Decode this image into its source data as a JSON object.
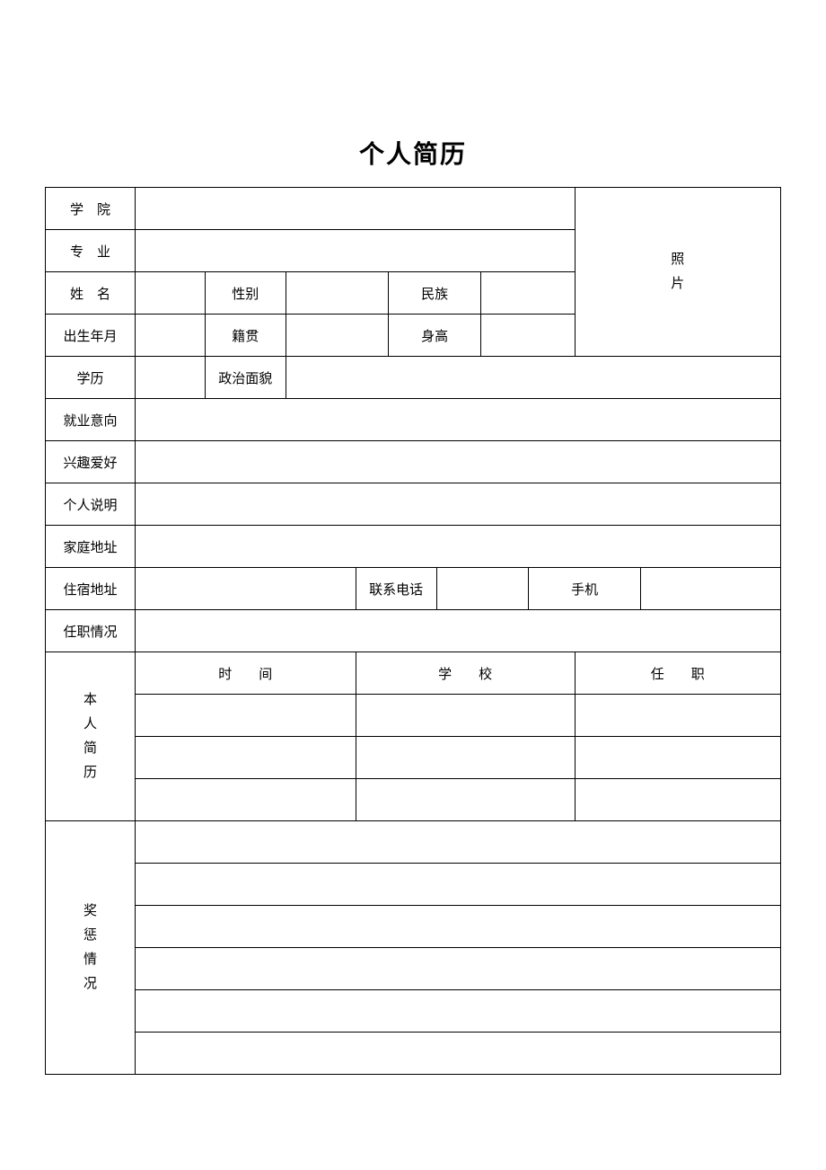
{
  "title": "个人简历",
  "labels": {
    "college": "学　院",
    "major": "专　业",
    "name": "姓　名",
    "gender": "性别",
    "ethnicity": "民族",
    "birth": "出生年月",
    "origin": "籍贯",
    "height": "身高",
    "education": "学历",
    "political": "政治面貌",
    "photo": "照片",
    "job_intent": "就业意向",
    "hobby": "兴趣爱好",
    "personal_desc": "个人说明",
    "home_addr": "家庭地址",
    "dorm_addr": "住宿地址",
    "phone": "联系电话",
    "mobile": "手机",
    "position_status": "任职情况",
    "resume_self": "本人简历",
    "time": "时　　间",
    "school": "学　　校",
    "position": "任　　职",
    "rewards": "奖惩情况"
  },
  "values": {
    "college": "",
    "major": "",
    "name": "",
    "gender": "",
    "ethnicity": "",
    "birth": "",
    "origin": "",
    "height": "",
    "education": "",
    "political": "",
    "job_intent": "",
    "hobby": "",
    "personal_desc": "",
    "home_addr": "",
    "dorm_addr": "",
    "phone": "",
    "mobile": "",
    "position_status": "",
    "resume_rows": [
      {
        "time": "",
        "school": "",
        "position": ""
      },
      {
        "time": "",
        "school": "",
        "position": ""
      },
      {
        "time": "",
        "school": "",
        "position": ""
      }
    ],
    "rewards": [
      "",
      "",
      "",
      "",
      "",
      ""
    ]
  }
}
